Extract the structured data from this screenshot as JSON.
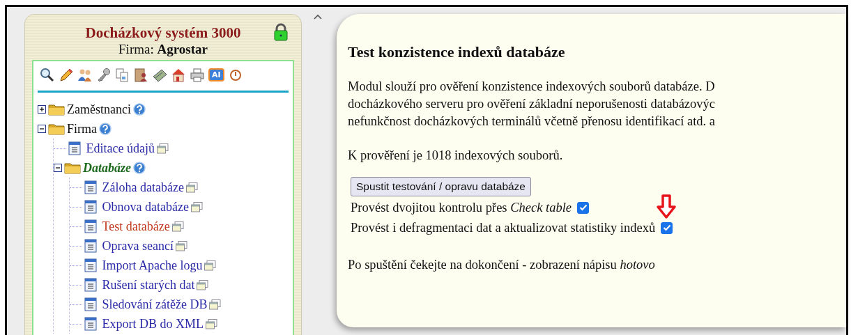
{
  "sidebar": {
    "title": "Docházkový systém 3000",
    "company": "Firma: **Agrostar**",
    "toolbar_badge": "AI",
    "tree": [
      {
        "label": "Zaměstnanci",
        "kind": "folder",
        "expanded": false,
        "selected": false
      },
      {
        "label": "Firma",
        "kind": "folder",
        "expanded": true,
        "selected": false,
        "children": [
          {
            "label": "Editace údajů",
            "kind": "page",
            "selected": false
          },
          {
            "label": "Databáze",
            "kind": "folder",
            "expanded": true,
            "selected": true,
            "children": [
              {
                "label": "Záloha databáze",
                "kind": "page",
                "selected": false
              },
              {
                "label": "Obnova databáze",
                "kind": "page",
                "selected": false
              },
              {
                "label": "Test databáze",
                "kind": "page",
                "selected": true
              },
              {
                "label": "Oprava seancí",
                "kind": "page",
                "selected": false
              },
              {
                "label": "Import Apache logu",
                "kind": "page",
                "selected": false
              },
              {
                "label": "Rušení starých dat",
                "kind": "page",
                "selected": false
              },
              {
                "label": "Sledování zátěže DB",
                "kind": "page",
                "selected": false
              },
              {
                "label": "Export DB do XML",
                "kind": "page",
                "selected": false
              }
            ]
          }
        ]
      }
    ]
  },
  "main": {
    "heading": "Test konzistence indexů databáze",
    "description_lines": [
      "Modul slouží pro ověření konzistence indexových souborů databáze. D",
      "docházkového serveru pro ověření základní neporušenosti databázovýc",
      "nefunkčnost docházkových terminálů včetně přenosu identifikací atd. a"
    ],
    "file_count": "K prověření je 1018 indexových souborů.",
    "button": "Spustit testování / opravu databáze",
    "options": [
      {
        "label": "Provést dvojitou kontrolu přes *Check table*",
        "checked": true,
        "highlighted": false
      },
      {
        "label": "Provést i defragmentaci dat a aktualizovat statistiky indexů",
        "checked": true,
        "highlighted": true
      }
    ],
    "note": "Po spuštění čekejte na dokončení - zobrazení nápisu *hotovo*"
  }
}
